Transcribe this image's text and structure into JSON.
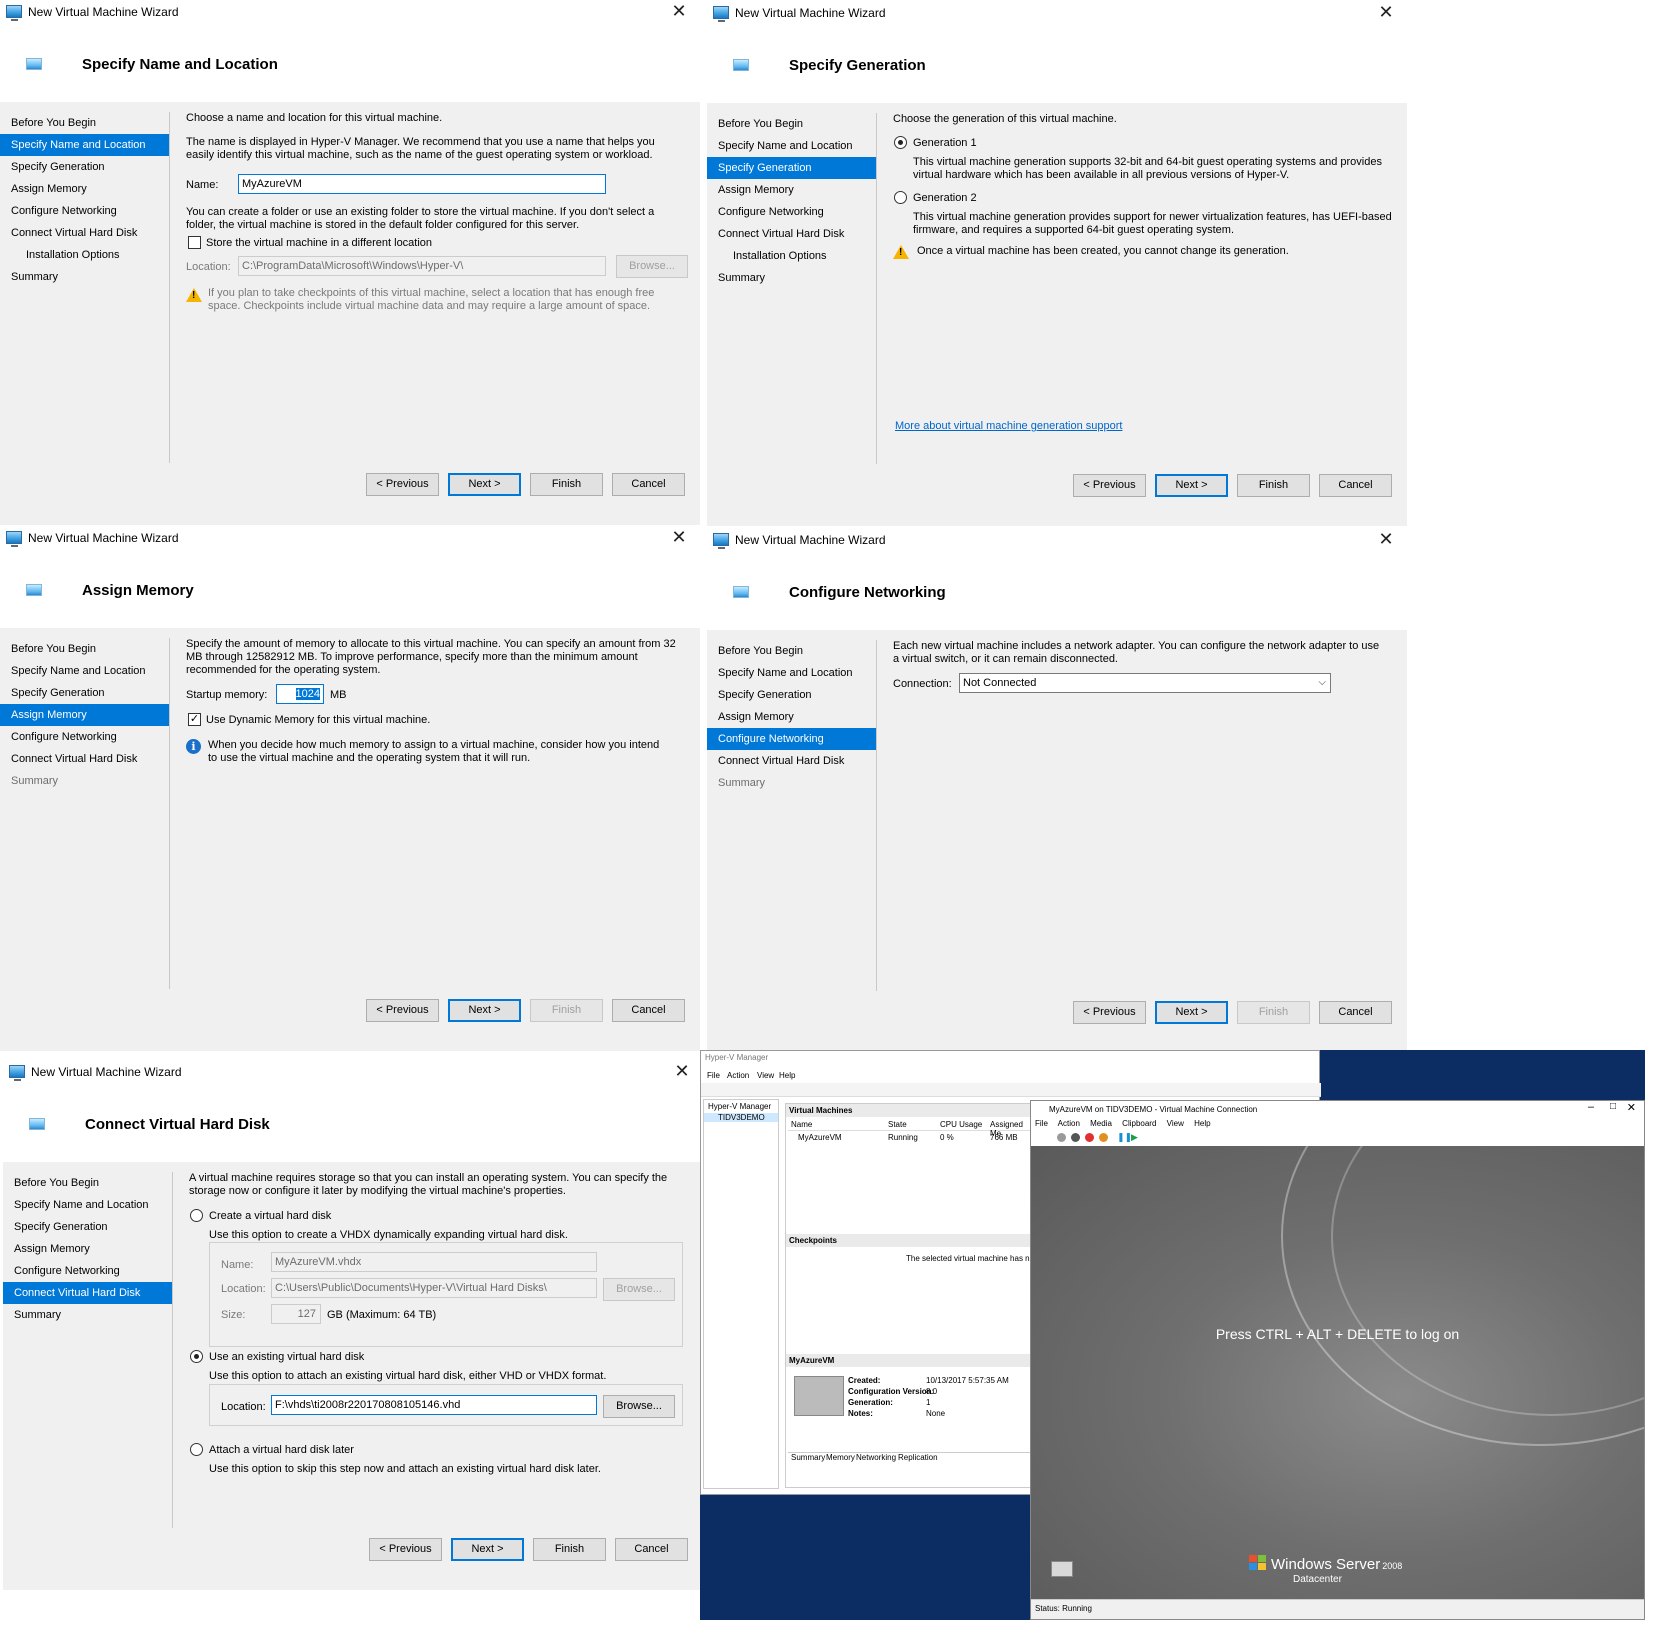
{
  "wizard_title": "New Virtual Machine Wizard",
  "nav_labels": {
    "before": "Before You Begin",
    "name": "Specify Name and Location",
    "generation": "Specify Generation",
    "memory": "Assign Memory",
    "networking": "Configure Networking",
    "disk": "Connect Virtual Hard Disk",
    "install": "Installation Options",
    "summary": "Summary"
  },
  "buttons": {
    "previous": "< Previous",
    "next": "Next >",
    "finish": "Finish",
    "cancel": "Cancel",
    "browse": "Browse..."
  },
  "w1": {
    "heading": "Specify Name and Location",
    "intro": "Choose a name and location for this virtual machine.",
    "desc": "The name is displayed in Hyper-V Manager. We recommend that you use a name that helps you easily identify this virtual machine, such as the name of the guest operating system or workload.",
    "name_label": "Name:",
    "name_value": "MyAzureVM",
    "folder_desc": "You can create a folder or use an existing folder to store the virtual machine. If you don't select a folder, the virtual machine is stored in the default folder configured for this server.",
    "store_label": "Store the virtual machine in a different location",
    "location_label": "Location:",
    "location_value": "C:\\ProgramData\\Microsoft\\Windows\\Hyper-V\\",
    "warning": "If you plan to take checkpoints of this virtual machine, select a location that has enough free space. Checkpoints include virtual machine data and may require a large amount of space."
  },
  "w2": {
    "heading": "Specify Generation",
    "intro": "Choose the generation of this virtual machine.",
    "gen1_label": "Generation 1",
    "gen1_desc": "This virtual machine generation supports 32-bit and 64-bit guest operating systems and provides virtual hardware which has been available in all previous versions of Hyper-V.",
    "gen2_label": "Generation 2",
    "gen2_desc": "This virtual machine generation provides support for newer virtualization features, has UEFI-based firmware, and requires a supported 64-bit guest operating system.",
    "warning": "Once a virtual machine has been created, you cannot change its generation.",
    "link": "More about virtual machine generation support"
  },
  "w3": {
    "heading": "Assign Memory",
    "intro": "Specify the amount of memory to allocate to this virtual machine. You can specify an amount from 32 MB through 12582912 MB. To improve performance, specify more than the minimum amount recommended for the operating system.",
    "startup_label": "Startup memory:",
    "startup_value": "1024",
    "unit": "MB",
    "dynamic_label": "Use Dynamic Memory for this virtual machine.",
    "info": "When you decide how much memory to assign to a virtual machine, consider how you intend to use the virtual machine and the operating system that it will run."
  },
  "w4": {
    "heading": "Configure Networking",
    "intro": "Each new virtual machine includes a network adapter. You can configure the network adapter to use a virtual switch, or it can remain disconnected.",
    "connection_label": "Connection:",
    "connection_value": "Not Connected"
  },
  "w5": {
    "heading": "Connect Virtual Hard Disk",
    "intro": "A virtual machine requires storage so that you can install an operating system. You can specify the storage now or configure it later by modifying the virtual machine's properties.",
    "create_label": "Create a virtual hard disk",
    "create_desc": "Use this option to create a VHDX dynamically expanding virtual hard disk.",
    "name_label": "Name:",
    "name_value": "MyAzureVM.vhdx",
    "location_label": "Location:",
    "location_value": "C:\\Users\\Public\\Documents\\Hyper-V\\Virtual Hard Disks\\",
    "size_label": "Size:",
    "size_value": "127",
    "size_unit": "GB (Maximum: 64 TB)",
    "existing_label": "Use an existing virtual hard disk",
    "existing_desc": "Use this option to attach an existing virtual hard disk, either VHD or VHDX format.",
    "existing_location_label": "Location:",
    "existing_location_value": "F:\\vhds\\ti2008r220170808105146.vhd",
    "later_label": "Attach a virtual hard disk later",
    "later_desc": "Use this option to skip this step now and attach an existing virtual hard disk later."
  },
  "hvm": {
    "title": "Hyper-V Manager",
    "menu": [
      "File",
      "Action",
      "View",
      "Help"
    ],
    "tree_root": "Hyper-V Manager",
    "tree_host": "TIDV3DEMO",
    "vm_section": "Virtual Machines",
    "cols": [
      "Name",
      "State",
      "CPU Usage",
      "Assigned Me"
    ],
    "vm_name": "MyAzureVM",
    "vm_state": "Running",
    "vm_cpu": "0 %",
    "vm_mem": "766 MB",
    "checkpoints": "Checkpoints",
    "checkpoints_msg": "The selected virtual machine has no check",
    "details_title": "MyAzureVM",
    "created_label": "Created:",
    "created_value": "10/13/2017 5:57:35 AM",
    "config_label": "Configuration Version:",
    "config_value": "8.0",
    "gen_label": "Generation:",
    "gen_value": "1",
    "notes_label": "Notes:",
    "notes_value": "None",
    "tabs": [
      "Summary",
      "Memory",
      "Networking",
      "Replication"
    ]
  },
  "vmc": {
    "title": "MyAzureVM on TIDV3DEMO - Virtual Machine Connection",
    "menu": [
      "File",
      "Action",
      "Media",
      "Clipboard",
      "View",
      "Help"
    ],
    "logon": "Press CTRL + ALT + DELETE to log on",
    "brand": "Windows Server",
    "brand_version": "2008",
    "edition": "Datacenter",
    "status": "Status: Running"
  }
}
